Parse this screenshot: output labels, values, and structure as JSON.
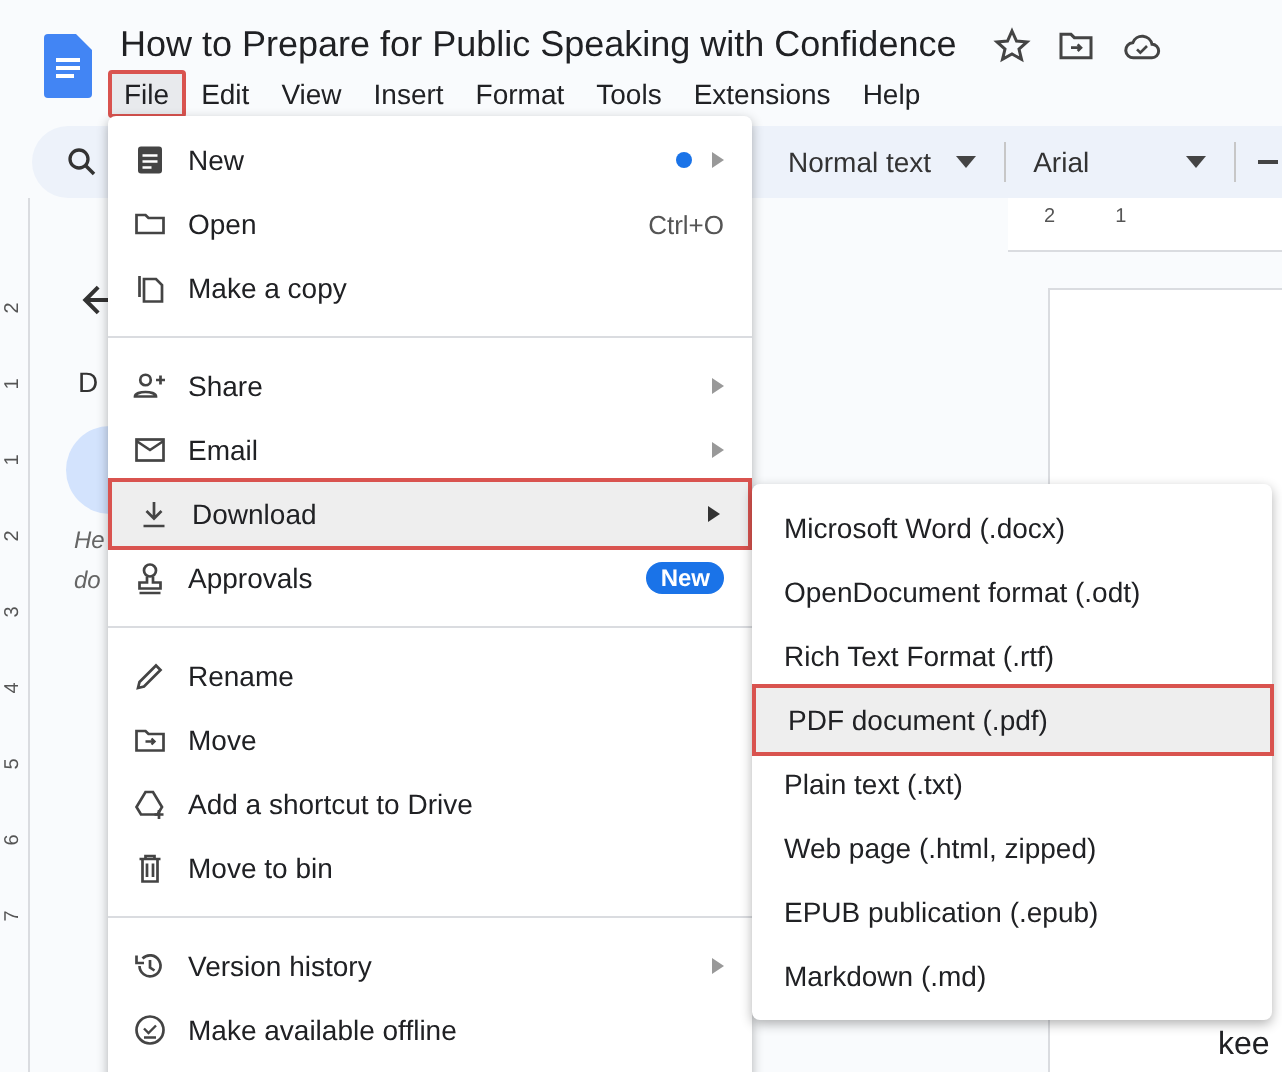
{
  "document": {
    "title": "How to Prepare for Public Speaking with Confidence"
  },
  "menu_bar": [
    {
      "label": "File",
      "highlighted": true
    },
    {
      "label": "Edit",
      "highlighted": false
    },
    {
      "label": "View",
      "highlighted": false
    },
    {
      "label": "Insert",
      "highlighted": false
    },
    {
      "label": "Format",
      "highlighted": false
    },
    {
      "label": "Tools",
      "highlighted": false
    },
    {
      "label": "Extensions",
      "highlighted": false
    },
    {
      "label": "Help",
      "highlighted": false
    }
  ],
  "toolbar": {
    "style": "Normal text",
    "font": "Arial"
  },
  "top_ruler": [
    "2",
    "1"
  ],
  "left_ruler": [
    "2",
    "1",
    "1",
    "2",
    "3",
    "4",
    "5",
    "6",
    "7"
  ],
  "sidebar": {
    "heading": "D",
    "note_lines": [
      "He",
      "do"
    ]
  },
  "page_text": "kee",
  "file_menu": [
    [
      {
        "label": "New",
        "submenu": true,
        "dot": true,
        "highlighted": false
      },
      {
        "label": "Open",
        "shortcut": "Ctrl+O",
        "submenu": false,
        "dot": false,
        "highlighted": false
      },
      {
        "label": "Make a copy",
        "submenu": false,
        "dot": false,
        "highlighted": false
      }
    ],
    [
      {
        "label": "Share",
        "submenu": true,
        "dot": false,
        "highlighted": false
      },
      {
        "label": "Email",
        "submenu": true,
        "dot": false,
        "highlighted": false
      },
      {
        "label": "Download",
        "submenu": true,
        "dot": false,
        "highlighted": true
      },
      {
        "label": "Approvals",
        "submenu": false,
        "dot": false,
        "badge": "New",
        "highlighted": false
      }
    ],
    [
      {
        "label": "Rename",
        "submenu": false,
        "dot": false,
        "highlighted": false
      },
      {
        "label": "Move",
        "submenu": false,
        "dot": false,
        "highlighted": false
      },
      {
        "label": "Add a shortcut to Drive",
        "submenu": false,
        "dot": false,
        "highlighted": false
      },
      {
        "label": "Move to bin",
        "submenu": false,
        "dot": false,
        "highlighted": false
      }
    ],
    [
      {
        "label": "Version history",
        "submenu": true,
        "dot": false,
        "highlighted": false
      },
      {
        "label": "Make available offline",
        "submenu": false,
        "dot": false,
        "highlighted": false
      }
    ]
  ],
  "download_menu": [
    {
      "label": "Microsoft Word (.docx)",
      "highlighted": false
    },
    {
      "label": "OpenDocument format (.odt)",
      "highlighted": false
    },
    {
      "label": "Rich Text Format (.rtf)",
      "highlighted": false
    },
    {
      "label": "PDF document (.pdf)",
      "highlighted": true
    },
    {
      "label": "Plain text (.txt)",
      "highlighted": false
    },
    {
      "label": "Web page (.html, zipped)",
      "highlighted": false
    },
    {
      "label": "EPUB publication (.epub)",
      "highlighted": false
    },
    {
      "label": "Markdown (.md)",
      "highlighted": false
    }
  ]
}
